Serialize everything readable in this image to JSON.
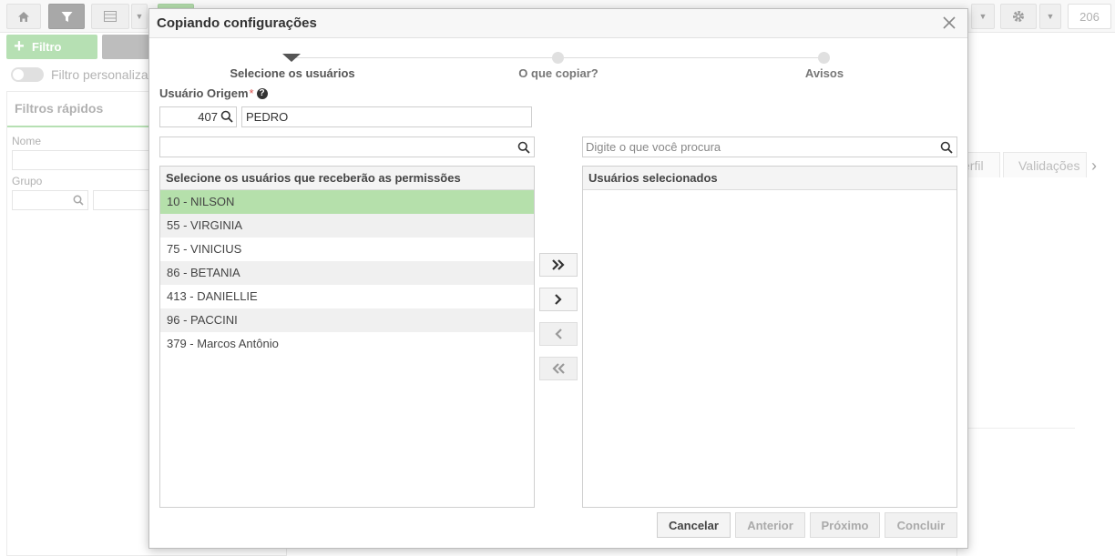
{
  "background": {
    "toolbar": {
      "page_number": "206"
    },
    "filter_button_label": "Filtro",
    "custom_filter_label": "Filtro personaliza",
    "quick_filters_title": "Filtros rápidos",
    "name_label": "Nome",
    "group_label": "Grupo",
    "tabs": [
      {
        "label": "erfil"
      },
      {
        "label": "Validações"
      }
    ]
  },
  "modal": {
    "title": "Copiando configurações",
    "steps": [
      {
        "label": "Selecione os usuários",
        "state": "current"
      },
      {
        "label": "O que copiar?",
        "state": "pending"
      },
      {
        "label": "Avisos",
        "state": "pending"
      }
    ],
    "origin_user": {
      "label": "Usuário Origem",
      "required_mark": "*",
      "code": "407",
      "name": "PEDRO"
    },
    "left_search": {
      "value": "",
      "placeholder": ""
    },
    "right_search": {
      "value": "",
      "placeholder": "Digite o que você procura"
    },
    "available_list": {
      "header": "Selecione os usuários que receberão as permissões",
      "items": [
        {
          "label": "10 - NILSON",
          "selected": true
        },
        {
          "label": "55 - VIRGINIA",
          "selected": false
        },
        {
          "label": "75 - VINICIUS",
          "selected": false
        },
        {
          "label": "86 - BETANIA",
          "selected": false
        },
        {
          "label": "413 - DANIELLIE",
          "selected": false
        },
        {
          "label": "96 - PACCINI",
          "selected": false
        },
        {
          "label": "379 - Marcos Antônio",
          "selected": false
        }
      ]
    },
    "selected_list": {
      "header": "Usuários selecionados",
      "items": []
    },
    "transfer_buttons": [
      {
        "name": "move-all-right",
        "icon": "double-chevron-right-icon",
        "enabled": true
      },
      {
        "name": "move-right",
        "icon": "chevron-right-icon",
        "enabled": true
      },
      {
        "name": "move-left",
        "icon": "chevron-left-icon",
        "enabled": false
      },
      {
        "name": "move-all-left",
        "icon": "double-chevron-left-icon",
        "enabled": false
      }
    ],
    "footer": {
      "cancel": "Cancelar",
      "previous": "Anterior",
      "next": "Próximo",
      "finish": "Concluir"
    }
  },
  "colors": {
    "accent_green": "#8fd08a",
    "selected_row": "#b5e0ab"
  }
}
